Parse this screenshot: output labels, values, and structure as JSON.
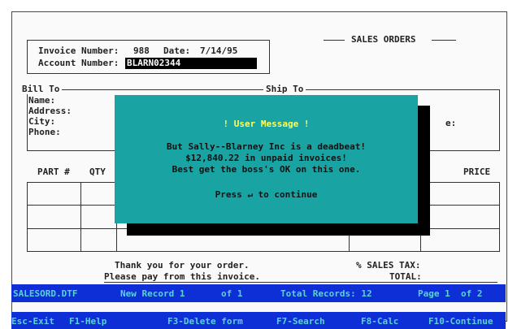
{
  "header": {
    "invoice_label": "Invoice Number:",
    "invoice_value": "988",
    "date_label": "Date:",
    "date_value": "7/14/95",
    "account_label": "Account Number:",
    "account_value": "BLARN02344",
    "title": "SALES ORDERS"
  },
  "billto": {
    "title": "Bill To",
    "name_label": "Name:",
    "address_label": "Address:",
    "city_label": "City:",
    "phone_label": "Phone:"
  },
  "shipto": {
    "title": "Ship To",
    "partial_label": "e:"
  },
  "table": {
    "col_part": "PART #",
    "col_qty": "QTY",
    "col_price": "PRICE"
  },
  "footer": {
    "thanks": "Thank you for your order.",
    "please_pay": "Please pay from this invoice.",
    "sales_tax_label": "% SALES TAX:",
    "total_label": "TOTAL:"
  },
  "dialog": {
    "title": "! User Message !",
    "line1": "But Sally--Blarney Inc is a deadbeat!",
    "line2": "$12,840.22 in unpaid invoices!",
    "line3": "Best get the boss's OK on this one.",
    "prompt": "Press ↵ to continue"
  },
  "status_bar": {
    "file": "SALESORD.DTF",
    "mode": "New Record 1",
    "of": "of 1",
    "total_records": "Total Records: 12",
    "page": "Page 1  of 2"
  },
  "function_keys": {
    "esc": "Esc-Exit",
    "f1": "F1-Help",
    "f3": "F3-Delete form",
    "f7": "F7-Search",
    "f8": "F8-Calc",
    "f10": "F10-Continue"
  }
}
